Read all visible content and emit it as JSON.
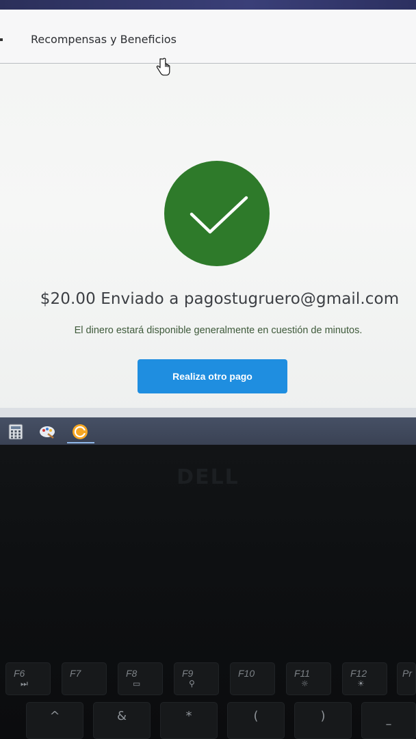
{
  "header": {
    "title": "Recompensas y Beneficios"
  },
  "confirmation": {
    "amount": "$20.00",
    "sent_to_label": "Enviado a",
    "recipient_email": "pagostugruero@gmail.com",
    "availability_note": "El dinero estará disponible generalmente en cuestión de minutos.",
    "another_payment_button": "Realiza otro pago"
  },
  "colors": {
    "success": "#2e7a2a",
    "primary_button": "#1f8ee0"
  },
  "taskbar": {
    "apps": [
      "calculator-icon",
      "paint-icon",
      "coin-app-icon"
    ]
  },
  "laptop": {
    "brand": "DELL",
    "keys": {
      "f6": "F6",
      "f7": "F7",
      "f8": "F8",
      "f9": "F9",
      "f10": "F10",
      "f11": "F11",
      "f12": "F12",
      "prt": "Pr",
      "caret": "^",
      "amp": "&",
      "star": "*",
      "lparen": "(",
      "rparen": ")",
      "minus": "–"
    }
  }
}
